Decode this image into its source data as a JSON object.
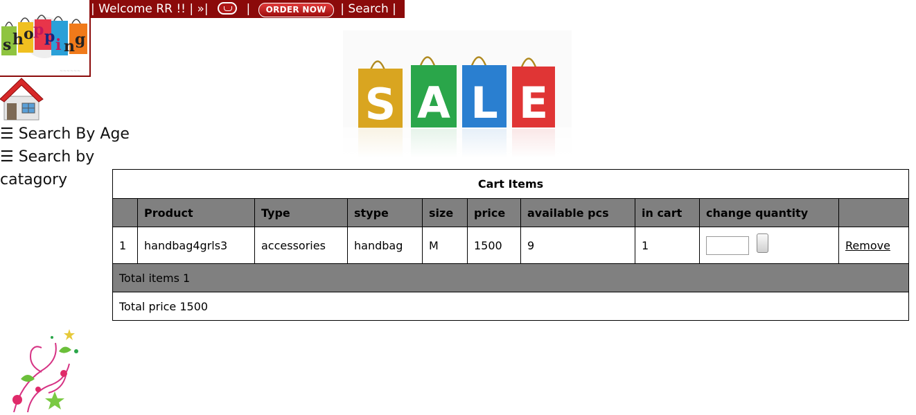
{
  "nav": {
    "welcome": "| Welcome RR !! | »|",
    "sep2": "|",
    "order_now": "ORDER NOW",
    "search": "| Search |"
  },
  "logo": {
    "letters": [
      "s",
      "h",
      "o",
      "p",
      "p",
      "i",
      "n",
      "g"
    ]
  },
  "banner": {
    "letters": [
      "S",
      "A",
      "L",
      "E"
    ]
  },
  "sidebar": {
    "items": [
      {
        "icon": "hamburger",
        "label": "☰ Search By Age"
      },
      {
        "icon": "hamburger",
        "label": "☰ Search by catagory"
      }
    ]
  },
  "cart": {
    "caption": "Cart Items",
    "headers": [
      "",
      "Product",
      "Type",
      "stype",
      "size",
      "price",
      "available pcs",
      "in cart",
      "change quantity",
      ""
    ],
    "rows": [
      {
        "index": "1",
        "product": "handbag4grls3",
        "type": "accessories",
        "stype": "handbag",
        "size": "M",
        "price": "1500",
        "available": "9",
        "in_cart": "1",
        "qty_value": "",
        "remove": "Remove"
      }
    ],
    "total_items": "Total items 1",
    "total_price": "Total price 1500"
  },
  "colors": {
    "nav_bg": "#8b0a0a",
    "table_header_bg": "#808080"
  }
}
